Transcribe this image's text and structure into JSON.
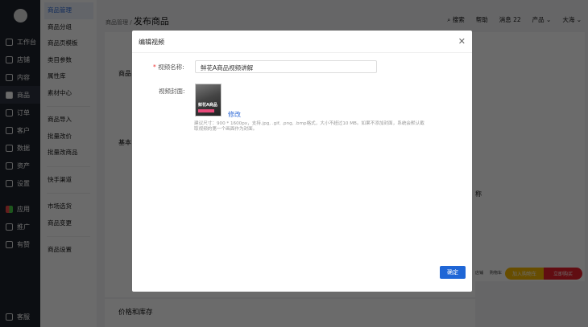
{
  "sidebar": {
    "items": [
      {
        "label": "工作台"
      },
      {
        "label": "店铺"
      },
      {
        "label": "内容"
      },
      {
        "label": "商品"
      },
      {
        "label": "订单"
      },
      {
        "label": "客户"
      },
      {
        "label": "数据"
      },
      {
        "label": "资产"
      },
      {
        "label": "设置"
      },
      {
        "label": "应用"
      },
      {
        "label": "推广"
      },
      {
        "label": "有赞"
      }
    ],
    "bottom": "客服"
  },
  "subnav": {
    "group1": [
      "商品管理",
      "商品分组",
      "商品页模板",
      "类目参数",
      "属性库",
      "素材中心"
    ],
    "group2": [
      "商品导入",
      "批量改价",
      "批量改商品"
    ],
    "group3": [
      "快手渠道"
    ],
    "group4": [
      "市场选货",
      "商品变更"
    ],
    "group5": [
      "商品设置"
    ]
  },
  "header": {
    "breadcrumb": "商品管理",
    "sep": "/",
    "title": "发布商品",
    "search": "搜索",
    "help": "帮助",
    "messages": "消息 22",
    "product": "产品",
    "user": "大海"
  },
  "page": {
    "section_price": "价格和库存",
    "partial1": "商品",
    "partial2": "基本",
    "partial3": "称"
  },
  "preview": {
    "shop": "店铺",
    "cart": "购物车",
    "add_cart": "加入购物车",
    "buy_now": "立即购买"
  },
  "modal": {
    "title": "编辑视频",
    "name_label": "视频名称:",
    "name_value": "鲜花A商品视频讲解",
    "cover_label": "视频封面:",
    "cover_text": "鲜花A商品",
    "edit_link": "修改",
    "hint": "建议尺寸：900 * 1600px，支持.jpg, .gif, .png, .bmp格式，大小不超过10 MB。如果不添加封面，系统会默认截取视频的第一个画面作为封面。",
    "confirm": "确定"
  }
}
